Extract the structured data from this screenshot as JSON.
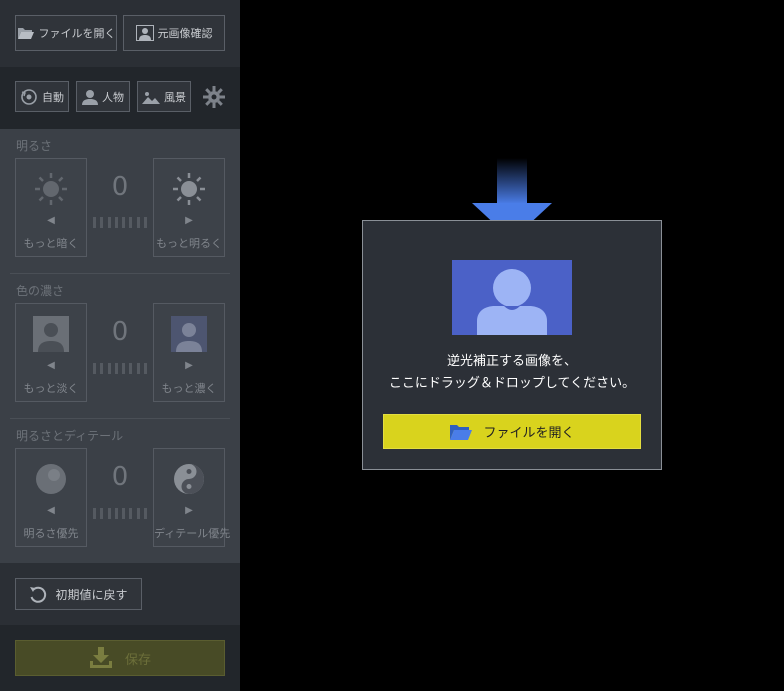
{
  "toolbar": {
    "open_file_label": "ファイルを開く",
    "view_original_label": "元画像確認"
  },
  "modes": {
    "auto_label": "自動",
    "person_label": "人物",
    "landscape_label": "風景",
    "settings_icon": "gear-icon"
  },
  "brightness": {
    "title": "明るさ",
    "value": "0",
    "decrease_label": "もっと暗く",
    "increase_label": "もっと明るく",
    "decrease_arrow": "◀",
    "increase_arrow": "▶"
  },
  "saturation": {
    "title": "色の濃さ",
    "value": "0",
    "decrease_label": "もっと淡く",
    "increase_label": "もっと濃く",
    "decrease_arrow": "◀",
    "increase_arrow": "▶"
  },
  "detail": {
    "title": "明るさとディテール",
    "value": "0",
    "decrease_label": "明るさ優先",
    "increase_label": "ディテール優先",
    "decrease_arrow": "◀",
    "increase_arrow": "▶"
  },
  "reset": {
    "label": "初期値に戻す"
  },
  "save": {
    "label": "保存"
  },
  "dropzone": {
    "line1": "逆光補正する画像を、",
    "line2": "ここにドラッグ＆ドロップしてください。",
    "open_button_label": "ファイルを開く"
  },
  "colors": {
    "accent_yellow": "#d9d31d",
    "drop_blue": "#4b61c7",
    "arrow_blue": "#4a7de8"
  }
}
